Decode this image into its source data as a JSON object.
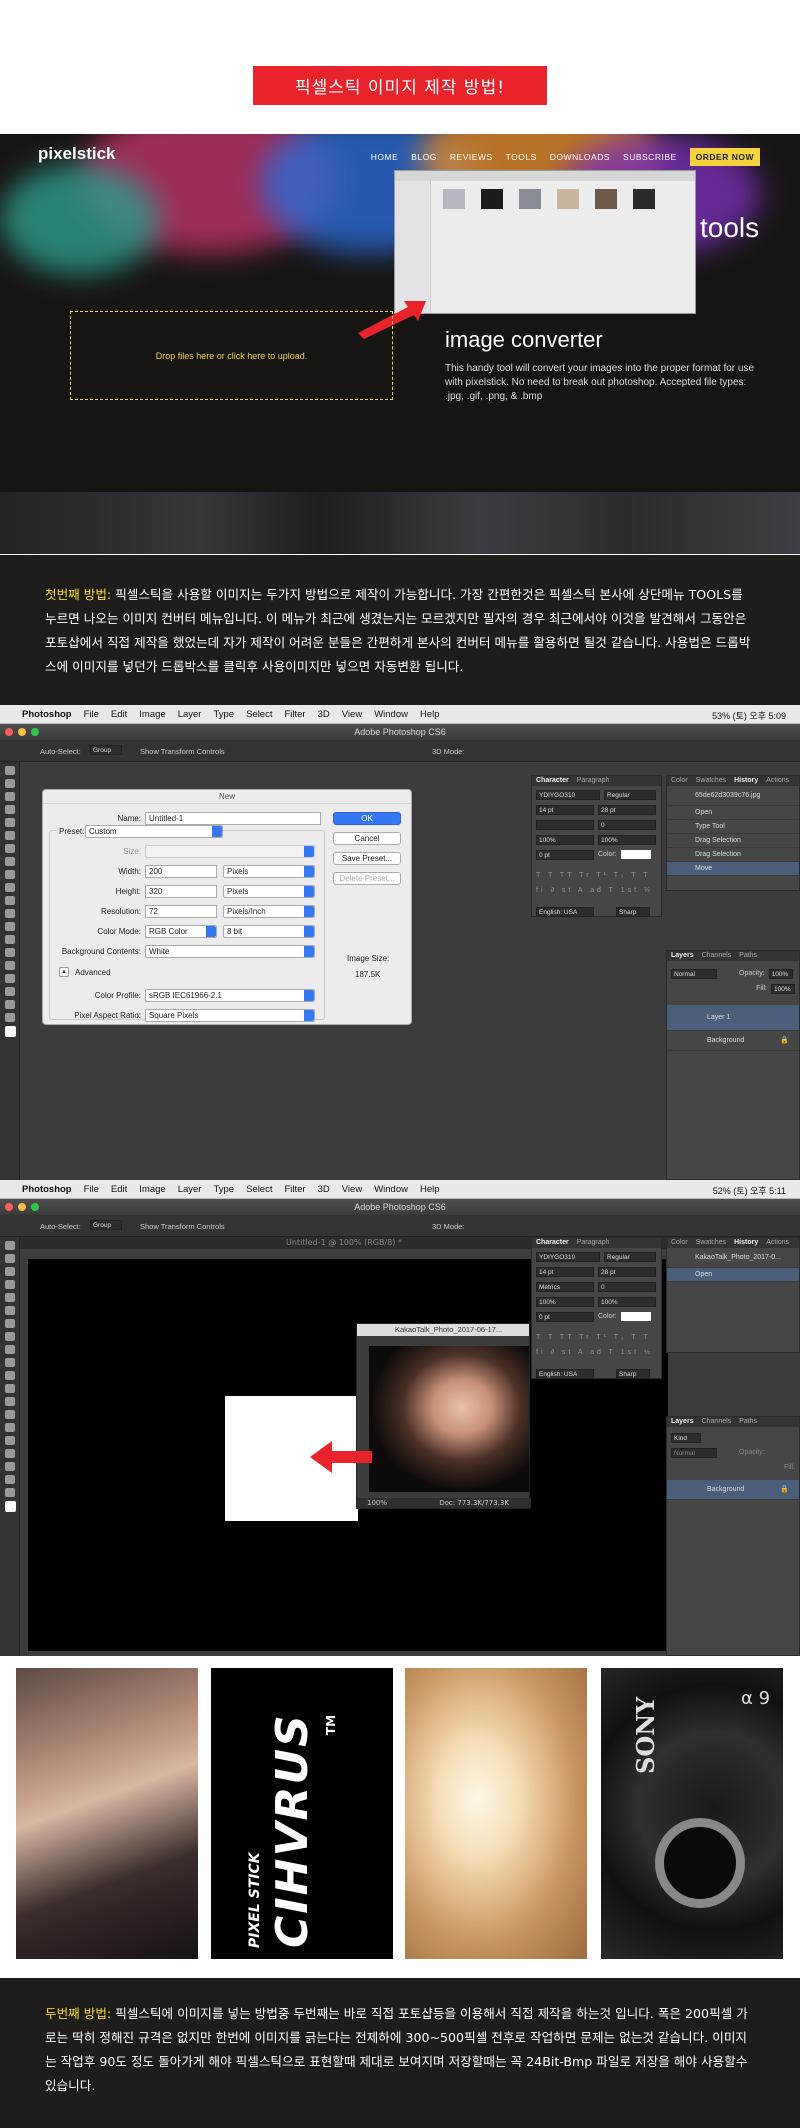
{
  "page_title": "픽셀스틱 이미지 제작 방법!",
  "website": {
    "logo": "pixelstick",
    "nav": [
      "HOME",
      "BLOG",
      "REVIEWS",
      "TOOLS",
      "DOWNLOADS",
      "SUBSCRIBE"
    ],
    "order_button": "ORDER NOW",
    "tools_label": "tools",
    "drop_zone_text": "Drop files here or click here to upload.",
    "converter_title": "image converter",
    "converter_desc": "This handy tool will convert your images into the proper format for use with pixelstick. No need to break out photoshop. Accepted file types: .jpg, .gif, .png, & .bmp"
  },
  "method1": {
    "label": "첫번째 방법:",
    "text": " 픽셀스틱을 사용할 이미지는 두가지 방법으로 제작이 가능합니다. 가장 간편한것은 픽셀스틱 본사에 상단메뉴 TOOLS를 누르면 나오는 이미지 컨버터 메뉴입니다. 이 메뉴가 최근에 생겼는지는 모르겠지만 필자의 경우 최근에서야 이것을 발견해서 그동안은 포토샵에서 직접 제작을 했었는데 자가 제작이 어려운 분들은 간편하게 본사의 컨버터 메뉴를 활용하면 될것 같습니다. 사용법은 드롭박스에 이미지를 넣던가 드롭박스를 클릭후 사용이미지만 넣으면 자동변환 됩니다."
  },
  "photoshop1": {
    "menu": [
      "Photoshop",
      "File",
      "Edit",
      "Image",
      "Layer",
      "Type",
      "Select",
      "Filter",
      "3D",
      "View",
      "Window",
      "Help"
    ],
    "status_right": "53%  (토) 오후 5:09",
    "window_title": "Adobe Photoshop CS6",
    "options_bar": [
      "Auto-Select:",
      "Group",
      "Show Transform Controls",
      "3D Mode:"
    ],
    "dialog": {
      "title": "New",
      "name_label": "Name:",
      "name_value": "Untitled-1",
      "preset_label": "Preset:",
      "preset_value": "Custom",
      "size_label": "Size:",
      "width_label": "Width:",
      "width_value": "200",
      "width_unit": "Pixels",
      "height_label": "Height:",
      "height_value": "320",
      "height_unit": "Pixels",
      "resolution_label": "Resolution:",
      "resolution_value": "72",
      "resolution_unit": "Pixels/Inch",
      "color_mode_label": "Color Mode:",
      "color_mode_value": "RGB Color",
      "bit_depth": "8 bit",
      "bg_label": "Background Contents:",
      "bg_value": "White",
      "advanced": "Advanced",
      "profile_label": "Color Profile:",
      "profile_value": "sRGB IEC61966-2.1",
      "aspect_label": "Pixel Aspect Ratio:",
      "aspect_value": "Square Pixels",
      "ok": "OK",
      "cancel": "Cancel",
      "save_preset": "Save Preset...",
      "delete_preset": "Delete Preset...",
      "image_size_label": "Image Size:",
      "image_size_value": "187.5K"
    },
    "character": {
      "tabs": [
        "Character",
        "Paragraph"
      ],
      "font": "YDIYGO310",
      "style": "Regular",
      "size": "14 pt",
      "leading": "28 pt",
      "tracking": "0",
      "vscale": "100%",
      "hscale": "100%",
      "baseline": "0 pt",
      "color_label": "Color:",
      "language": "English: USA",
      "aa": "Sharp"
    },
    "history": {
      "tabs": [
        "Color",
        "Swatches",
        "History",
        "Actions"
      ],
      "snapshot": "65de62d3039c76.jpg",
      "items": [
        "Open",
        "Type Tool",
        "Drag Selection",
        "Drag Selection",
        "Move"
      ]
    },
    "layers": {
      "tabs": [
        "Layers",
        "Channels",
        "Paths"
      ],
      "blend": "Normal",
      "opacity_label": "Opacity:",
      "opacity": "100%",
      "fill_label": "Fill:",
      "fill": "100%",
      "items": [
        "Layer 1",
        "Background"
      ]
    }
  },
  "photoshop2": {
    "status_right": "52%  (토) 오후 5:11",
    "window_title": "Adobe Photoshop CS6",
    "doc_tab": "Untitled-1 @ 100% (RGB/8) *",
    "kakao_title": "KakaoTalk_Photo_2017-06-17...",
    "kakao_zoom": "100%",
    "kakao_doc": "Doc: 773.3K/773.3K",
    "history": {
      "snapshot": "KakaoTalk_Photo_2017-0...",
      "items": [
        "Open"
      ]
    },
    "layers": {
      "kind": "Kind",
      "blend": "Normal",
      "items": [
        "Background"
      ]
    },
    "character": {
      "font": "YDIYGO310",
      "style": "Regular",
      "size": "14 pt",
      "leading": "28 pt",
      "kerning": "Metrics",
      "language": "English: USA",
      "aa": "Sharp"
    }
  },
  "gallery": {
    "brand_top": "PIXEL STICK",
    "brand_main": "CIHVRUS",
    "brand_tm": "TM",
    "camera_brand": "SONY",
    "camera_model": "α 9"
  },
  "method2": {
    "label": "두번째 방법:",
    "text": " 픽셀스틱에 이미지를 넣는 방법중 두번째는 바로 직접 포토샵등을 이용해서 직접 제작을 하는것 입니다. 폭은 200픽셀 가로는 딱히 정해진 규격은 없지만 한번에 이미지를 긁는다는 전제하에 300~500픽셀 전후로 작업하면 문제는 없는것 같습니다. 이미지는 작업후 90도 정도 돌아가게 해야 픽셀스틱으로 표현할때 제대로 보여지며 저장할때는 꼭 24Bit-Bmp 파일로 저장을 해야 사용할수 있습니다."
  },
  "colors": {
    "accent_red": "#e8232b",
    "highlight_yellow": "#f4dc3a",
    "ps_selection": "#4b5f7d"
  }
}
